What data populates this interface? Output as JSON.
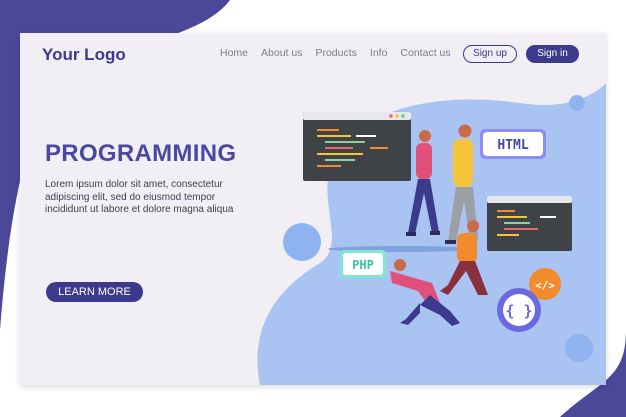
{
  "header": {
    "logo": "Your Logo",
    "nav": [
      {
        "label": "Home"
      },
      {
        "label": "About us"
      },
      {
        "label": "Products"
      },
      {
        "label": "Info"
      },
      {
        "label": "Contact us"
      }
    ],
    "signup_label": "Sign up",
    "signin_label": "Sign in"
  },
  "hero": {
    "title": "PROGRAMMING",
    "description": "Lorem ipsum dolor sit amet, consectetur adipiscing elit, sed do eiusmod tempor incididunt ut labore et dolore magna aliqua",
    "cta_label": "LEARN MORE"
  },
  "illustration": {
    "html_badge": "HTML",
    "php_badge": "PHP",
    "code_badge": "</>",
    "braces_badge": "{ }",
    "code_tag": "</>"
  },
  "colors": {
    "primary": "#3b3a8c",
    "card_bg": "#f2eff4",
    "blob": "#a9c4f2",
    "html_badge": "#8e8cf0",
    "php_badge": "#7fe8cf",
    "orange_badge": "#f28a2e"
  }
}
